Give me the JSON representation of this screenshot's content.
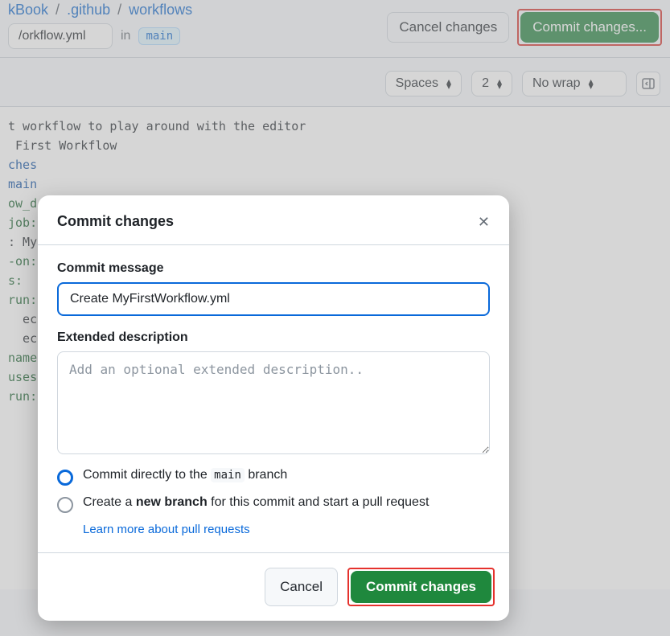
{
  "breadcrumb": {
    "part1": "kBook",
    "part2": ".github",
    "part3": "workflows",
    "sep": "/"
  },
  "file_row": {
    "filename_fragment": "/orkflow.yml",
    "in_text": "in",
    "branch": "main"
  },
  "top_buttons": {
    "cancel": "Cancel changes",
    "commit": "Commit changes..."
  },
  "editor_toolbar": {
    "indent_type": "Spaces",
    "indent_width": "2",
    "wrap": "No wrap"
  },
  "code": {
    "l1": "t workflow to play around with the editor",
    "l2": " First Workflow",
    "l3": "",
    "l4": "ches",
    "l5": "main",
    "l6": "ow_d",
    "l7": "",
    "l8": "",
    "l9": "job:",
    "l10": ": My",
    "l11": "-on:",
    "l12": "s:",
    "l13_p1": "run:",
    "l14": "  ec",
    "l15": "  ec",
    "l16_p1": "name",
    "l17_p1": "uses",
    "l18_p1": "run:"
  },
  "dialog": {
    "title": "Commit changes",
    "commit_message_label": "Commit message",
    "commit_message_value": "Create MyFirstWorkflow.yml",
    "extended_label": "Extended description",
    "extended_placeholder": "Add an optional extended description..",
    "radio1_pre": "Commit directly to the ",
    "radio1_branch": "main",
    "radio1_post": " branch",
    "radio2_pre": "Create a ",
    "radio2_bold": "new branch",
    "radio2_post": " for this commit and start a pull request",
    "learn_more": "Learn more about pull requests",
    "cancel": "Cancel",
    "commit": "Commit changes"
  }
}
